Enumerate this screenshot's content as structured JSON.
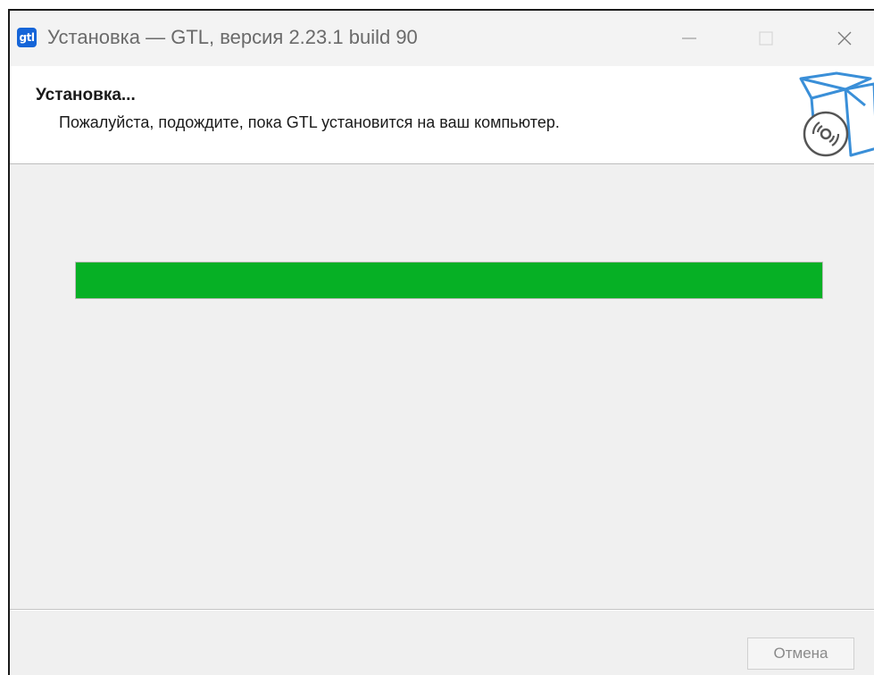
{
  "window": {
    "app_icon_text": "gtl",
    "title": "Установка — GTL, версия 2.23.1 build 90",
    "controls": {
      "minimize": "minimize-icon",
      "maximize": "maximize-icon",
      "close": "close-icon"
    }
  },
  "header": {
    "title": "Установка...",
    "subtitle": "Пожалуйста, подождите, пока GTL установится на ваш компьютер.",
    "icon": "install-box-icon"
  },
  "progress": {
    "value": 1.0,
    "color": "#06b025"
  },
  "footer": {
    "cancel_label": "Отмена"
  }
}
